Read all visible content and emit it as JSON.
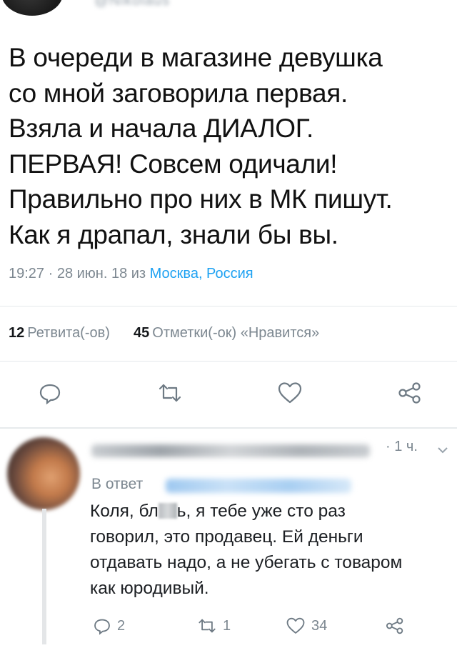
{
  "tweet": {
    "lines": [
      "В очереди в магазине девушка",
      "со мной заговорила первая.",
      "Взяла и начала ДИАЛОГ.",
      "ПЕРВАЯ! Совсем одичали!",
      "Правильно про них в МК пишут.",
      "Как я драпал, знали бы вы."
    ],
    "meta_prefix": "19:27 · 28 июн. 18 из ",
    "location": "Москва, Россия"
  },
  "stats": {
    "retweets_count": "12",
    "retweets_label": "Ретвита(-ов)",
    "likes_count": "45",
    "likes_label": "Отметки(-ок) «Нравится»"
  },
  "actions": [
    "reply-icon",
    "retweet-icon",
    "like-icon",
    "share-icon"
  ],
  "reply": {
    "time": "· 1 ч.",
    "reply_prefix": "В ответ",
    "lines": [
      [
        "Коля, бл",
        "ь, я тебе уже сто раз"
      ],
      "говорил, это продавец. Ей деньги",
      "отдавать надо, а не убегать с товаром",
      "как юродивый."
    ],
    "reply_count": "2",
    "retweet_count": "1",
    "like_count": "34"
  },
  "colors": {
    "text": "#14171a",
    "muted": "#7c8790",
    "link": "#1da1f2",
    "divider": "#e4e8eb"
  }
}
